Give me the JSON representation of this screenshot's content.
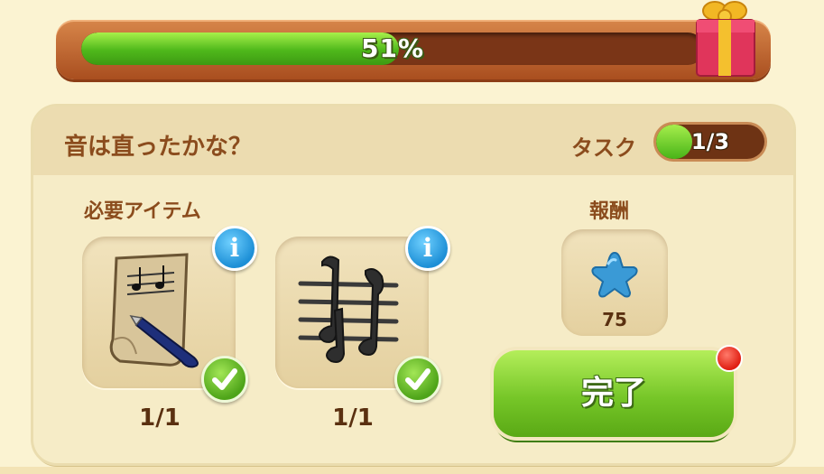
{
  "progress": {
    "percent": 51,
    "label": "51%"
  },
  "quest": {
    "title": "音は直ったかな？",
    "task_label": "タスク",
    "task_progress": "1/3",
    "task_fraction": 0.33
  },
  "required": {
    "label": "必要アイテム",
    "items": [
      {
        "icon": "sheet-music-quill-icon",
        "count": "1/1",
        "done": true
      },
      {
        "icon": "music-notes-staff-icon",
        "count": "1/1",
        "done": true
      }
    ]
  },
  "reward": {
    "label": "報酬",
    "icon": "blue-star-icon",
    "quantity": "75"
  },
  "complete_button": {
    "label": "完了"
  },
  "colors": {
    "accent_green": "#76c628",
    "brown_text": "#8b4c1d",
    "info_blue": "#1d8fd6"
  }
}
